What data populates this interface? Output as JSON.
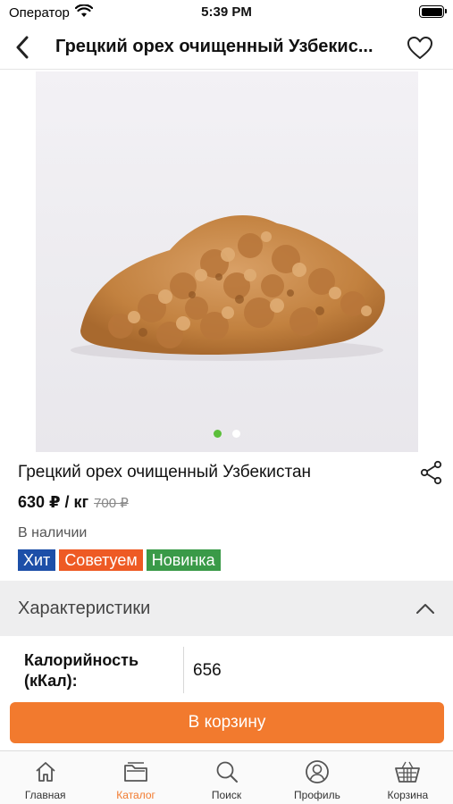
{
  "status_bar": {
    "carrier": "Оператор",
    "time": "5:39 PM"
  },
  "header": {
    "title": "Грецкий орех очищенный Узбекис..."
  },
  "gallery": {
    "image_count": 2,
    "active_index": 0
  },
  "product": {
    "name": "Грецкий орех очищенный Узбекистан",
    "price": "630 ₽ / кг",
    "old_price": "700 ₽",
    "availability": "В наличии",
    "badges": [
      {
        "label": "Хит",
        "color": "#1d4fa8"
      },
      {
        "label": "Советуем",
        "color": "#ee5a24"
      },
      {
        "label": "Новинка",
        "color": "#3a9a48"
      }
    ]
  },
  "specs": {
    "title": "Характеристики",
    "rows": [
      {
        "key": "Калорийность (кКал):",
        "value": "656"
      }
    ]
  },
  "cart_button": {
    "label": "В корзину"
  },
  "tab_bar": {
    "items": [
      {
        "label": "Главная",
        "icon": "home-icon",
        "active": false
      },
      {
        "label": "Каталог",
        "icon": "catalog-icon",
        "active": true
      },
      {
        "label": "Поиск",
        "icon": "search-icon",
        "active": false
      },
      {
        "label": "Профиль",
        "icon": "profile-icon",
        "active": false
      },
      {
        "label": "Корзина",
        "icon": "cart-icon",
        "active": false
      }
    ]
  },
  "colors": {
    "accent": "#f27a2e",
    "active_dot": "#5cbf3b"
  }
}
